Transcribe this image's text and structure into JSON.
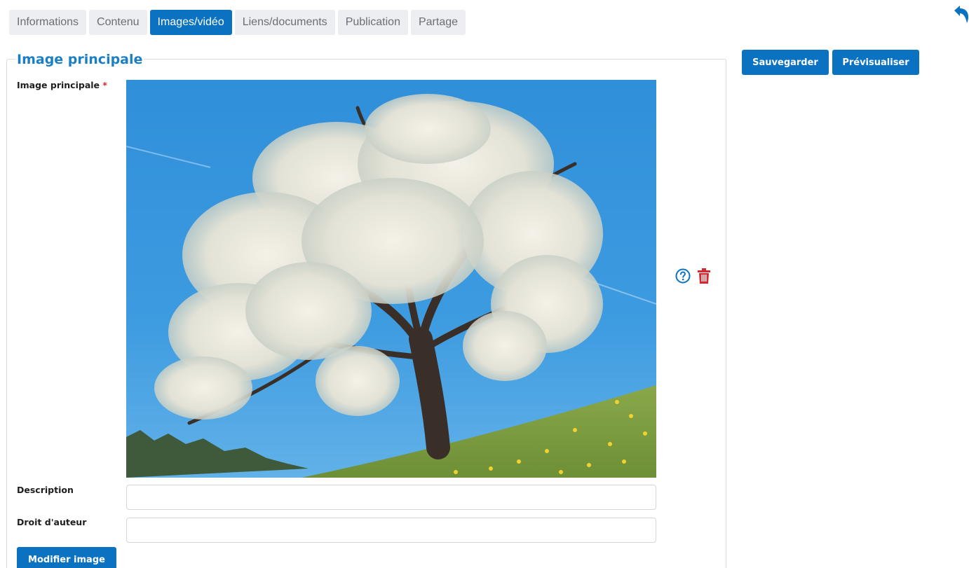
{
  "tabs": [
    {
      "label": "Informations",
      "active": false
    },
    {
      "label": "Contenu",
      "active": false
    },
    {
      "label": "Images/vidéo",
      "active": true
    },
    {
      "label": "Liens/documents",
      "active": false
    },
    {
      "label": "Publication",
      "active": false
    },
    {
      "label": "Partage",
      "active": false
    }
  ],
  "icons": {
    "back": "undo-arrow-icon",
    "help": "question-circle-icon",
    "delete": "trash-icon"
  },
  "section": {
    "legend": "Image principale",
    "image_label": "Image principale",
    "required_mark": "*",
    "image_alt": "Cerisier en fleurs sur une colline sous un ciel bleu",
    "description_label": "Description",
    "description_value": "",
    "copyright_label": "Droit d'auteur",
    "copyright_value": "",
    "modify_button": "Modifier image"
  },
  "actions": {
    "save": "Sauvegarder",
    "preview": "Prévisualiser"
  },
  "colors": {
    "accent": "#0a72c0",
    "legend": "#1a7fc4",
    "danger": "#d6282f",
    "tab_inactive_bg": "#eceef1",
    "tab_inactive_text": "#6a6f76"
  }
}
